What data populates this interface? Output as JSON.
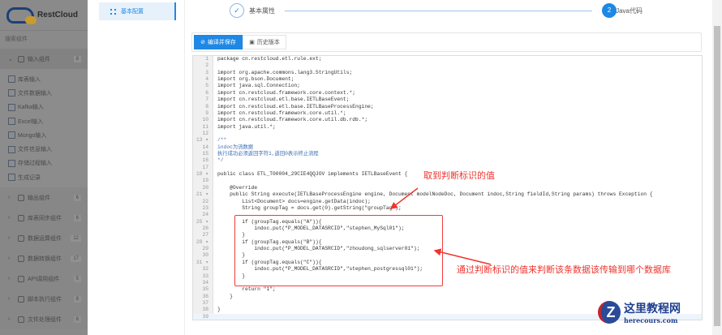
{
  "brand": "RestCloud",
  "sidebar": {
    "search_placeholder": "搜索组件",
    "open_group": {
      "label": "输入组件",
      "count": "8",
      "items": [
        "库表输入",
        "文件数据输入",
        "Kafka输入",
        "Excel输入",
        "Mongo输入",
        "文件信息输入",
        "存储过程输入",
        "生成记录"
      ]
    },
    "groups": [
      {
        "label": "输出组件",
        "count": "6"
      },
      {
        "label": "库表同步组件",
        "count": "6"
      },
      {
        "label": "数据运算组件",
        "count": "12"
      },
      {
        "label": "数据转换组件",
        "count": "17"
      },
      {
        "label": "API调用组件",
        "count": "5"
      },
      {
        "label": "脚本执行组件",
        "count": "8"
      },
      {
        "label": "文件处理组件",
        "count": "6"
      }
    ]
  },
  "panel": {
    "item": "基本配置"
  },
  "steps": {
    "step1": "基本属性",
    "step2_num": "2",
    "step2": "Java代码"
  },
  "toolbar": {
    "save": "编译并保存",
    "history": "历史版本"
  },
  "code": [
    "package cn.restcloud.etl.rule.ext;",
    "",
    "import org.apache.commons.lang3.StringUtils;",
    "import org.bson.Document;",
    "import java.sql.Connection;",
    "import cn.restcloud.framework.core.context.*;",
    "import cn.restcloud.etl.base.IETLBaseEvent;",
    "import cn.restcloud.etl.base.IETLBaseProcessEngine;",
    "import cn.restcloud.framework.core.util.*;",
    "import cn.restcloud.framework.core.util.db.rdb.*;",
    "import java.util.*;",
    "",
    "/**",
    "indoc为流数据",
    "执行成功必须返回字符1,返回0表示终止流程",
    "*/",
    "",
    "public class ETL_T00004_29CIE4QQJOV implements IETLBaseEvent {",
    "",
    "    @Override",
    "    public String execute(IETLBaseProcessEngine engine, Document modelNodeDoc, Document indoc,String fieldId,String params) throws Exception {",
    "        List<Document> docs=engine.getData(indoc);",
    "        String groupTag = docs.get(0).getString(\"groupTag\");",
    "",
    "        if (groupTag.equals(\"A\")){",
    "            indoc.put(\"P_MODEL_DATASRCID\",\"stephen_MySql01\");",
    "        }",
    "        if (groupTag.equals(\"B\")){",
    "            indoc.put(\"P_MODEL_DATASRCID\",\"zhoudong_sqlserver01\");",
    "        }",
    "        if (groupTag.equals(\"C\")){",
    "            indoc.put(\"P_MODEL_DATASRCID\",\"stephen_postgressql01\");",
    "        }",
    "",
    "        return \"1\";",
    "    }",
    "",
    "}",
    ""
  ],
  "annotations": {
    "top": "取到判断标识的值",
    "bottom": "通过判断标识的值来判断该条数据该传输到哪个数据库"
  },
  "watermark": {
    "title": "这里教程网",
    "url": "herecours.com"
  }
}
